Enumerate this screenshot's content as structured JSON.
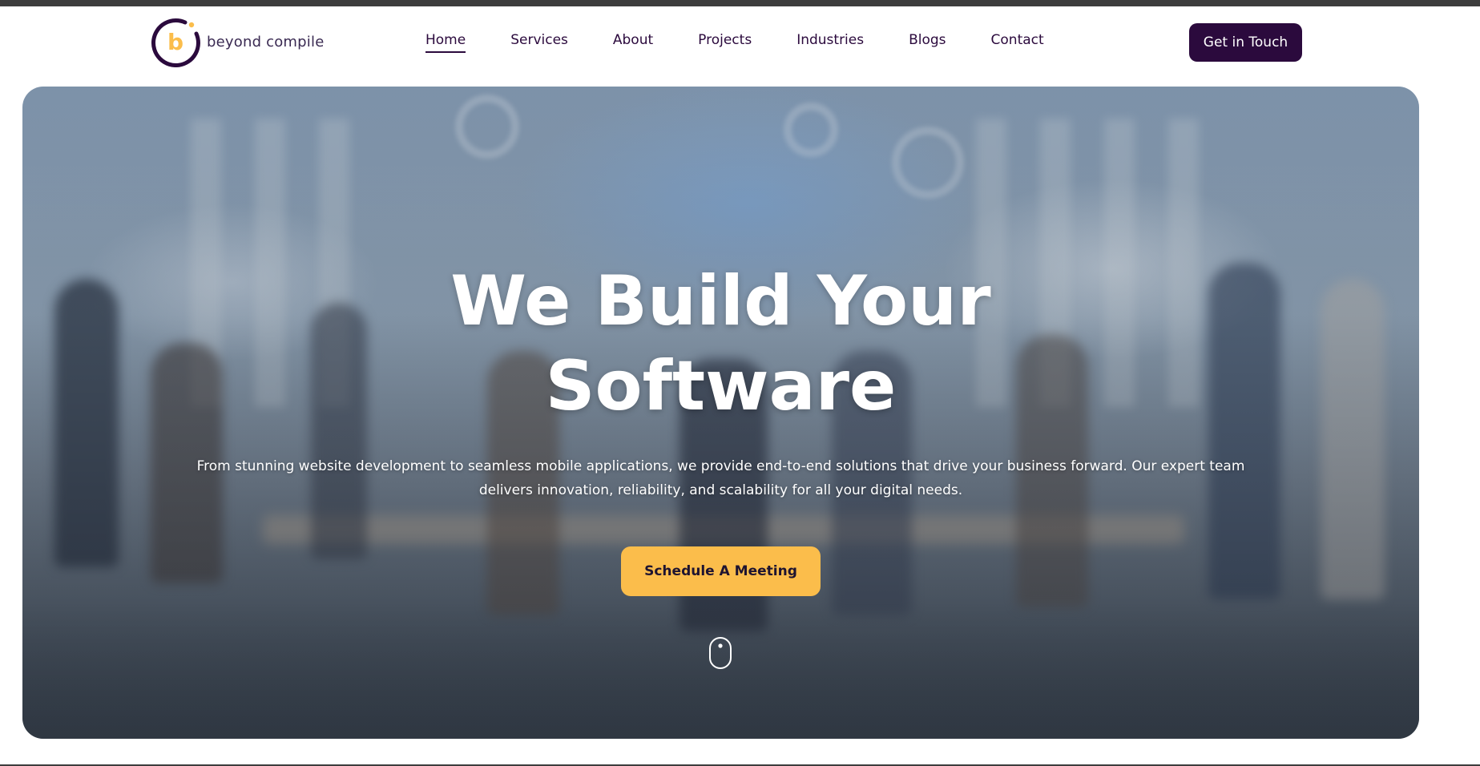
{
  "brand": {
    "name": "beyond compile",
    "logo_letter": "b",
    "colors": {
      "primary": "#2b0a3d",
      "accent": "#fbbd4b",
      "logo_ring": "#2b0a3d"
    }
  },
  "nav": {
    "items": [
      {
        "label": "Home",
        "active": true
      },
      {
        "label": "Services"
      },
      {
        "label": "About"
      },
      {
        "label": "Projects"
      },
      {
        "label": "Industries"
      },
      {
        "label": "Blogs"
      },
      {
        "label": "Contact"
      }
    ],
    "cta_label": "Get in Touch"
  },
  "hero": {
    "title_line1": "We Build Your",
    "title_line2": "Software",
    "subtitle": "From stunning website development to seamless mobile applications, we provide end-to-end solutions that drive your business forward. Our expert team delivers innovation, reliability, and scalability for all your digital needs.",
    "cta_label": "Schedule A Meeting",
    "scroll_icon": "mouse-scroll-icon"
  }
}
